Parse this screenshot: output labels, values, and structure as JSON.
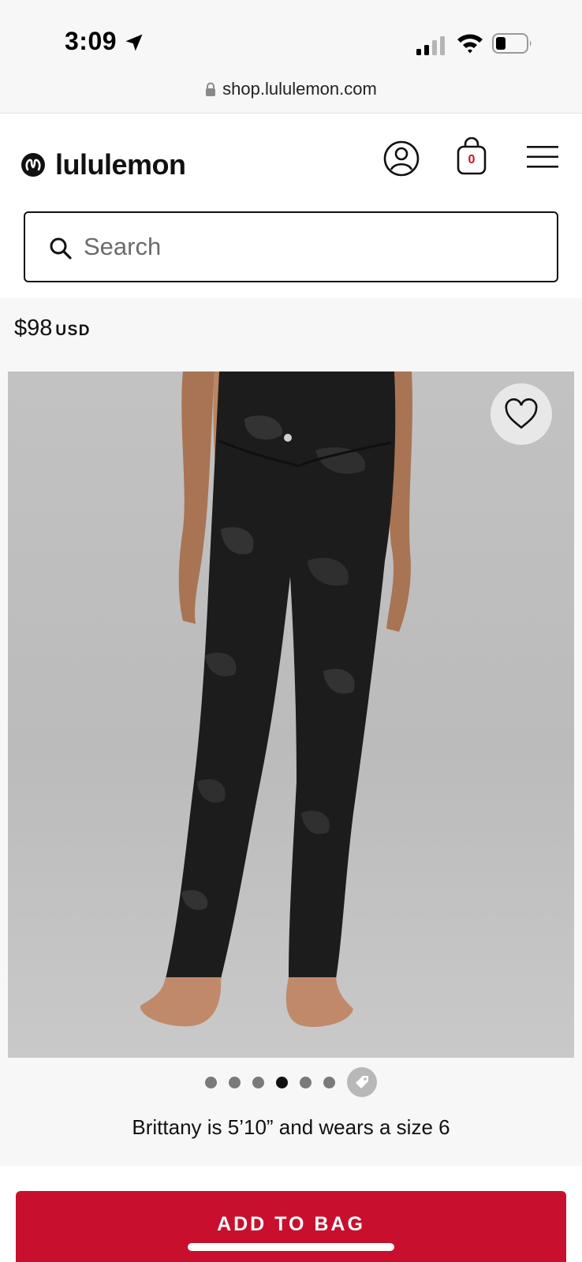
{
  "status_bar": {
    "time": "3:09",
    "icons": [
      "location-arrow-icon",
      "signal-icon",
      "wifi-icon",
      "battery-icon"
    ]
  },
  "url_bar": {
    "url": "shop.lululemon.com",
    "icon": "lock-icon"
  },
  "header": {
    "logo_text": "lululemon",
    "bag_count": "0",
    "icons": [
      "account-icon",
      "shopping-bag-icon",
      "menu-icon"
    ]
  },
  "search": {
    "placeholder": "Search",
    "value": ""
  },
  "product": {
    "price": "$98",
    "currency": "USD",
    "image": "black camo high-rise leggings, back view",
    "model_caption": "Brittany is 5’10” and wears a size 6",
    "carousel": {
      "total_images": 6,
      "active_index": 3
    },
    "add_to_bag_label": "ADD TO BAG"
  },
  "colors": {
    "brand_red": "#c8102e",
    "text": "#111111",
    "background": "#f7f7f7"
  }
}
